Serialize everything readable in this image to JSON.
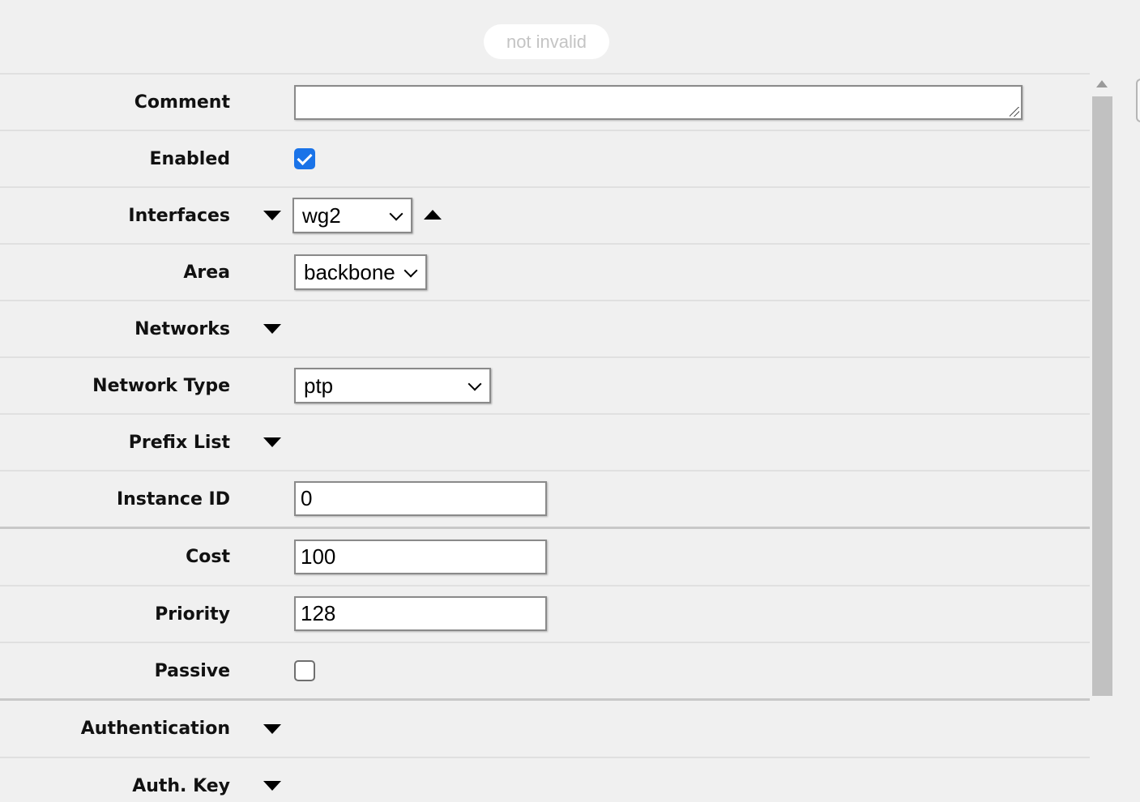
{
  "status": {
    "text": "not invalid"
  },
  "form": {
    "comment": {
      "label": "Comment",
      "value": ""
    },
    "enabled": {
      "label": "Enabled",
      "checked": true
    },
    "interfaces": {
      "label": "Interfaces",
      "selected": "wg2"
    },
    "area": {
      "label": "Area",
      "selected": "backbone"
    },
    "networks": {
      "label": "Networks"
    },
    "network_type": {
      "label": "Network Type",
      "selected": "ptp"
    },
    "prefix_list": {
      "label": "Prefix List"
    },
    "instance_id": {
      "label": "Instance ID",
      "value": "0"
    },
    "cost": {
      "label": "Cost",
      "value": "100"
    },
    "priority": {
      "label": "Priority",
      "value": "128"
    },
    "passive": {
      "label": "Passive",
      "checked": false
    },
    "authentication": {
      "label": "Authentication"
    },
    "auth_key": {
      "label": "Auth. Key"
    }
  },
  "icons": {
    "expand": "triangle-down-icon",
    "collapse": "triangle-up-icon",
    "dropdown": "chevron-down-icon"
  },
  "colors": {
    "background": "#f0f0f0",
    "checkbox_accent": "#1a73e8",
    "status_text": "#c4c4c4"
  }
}
